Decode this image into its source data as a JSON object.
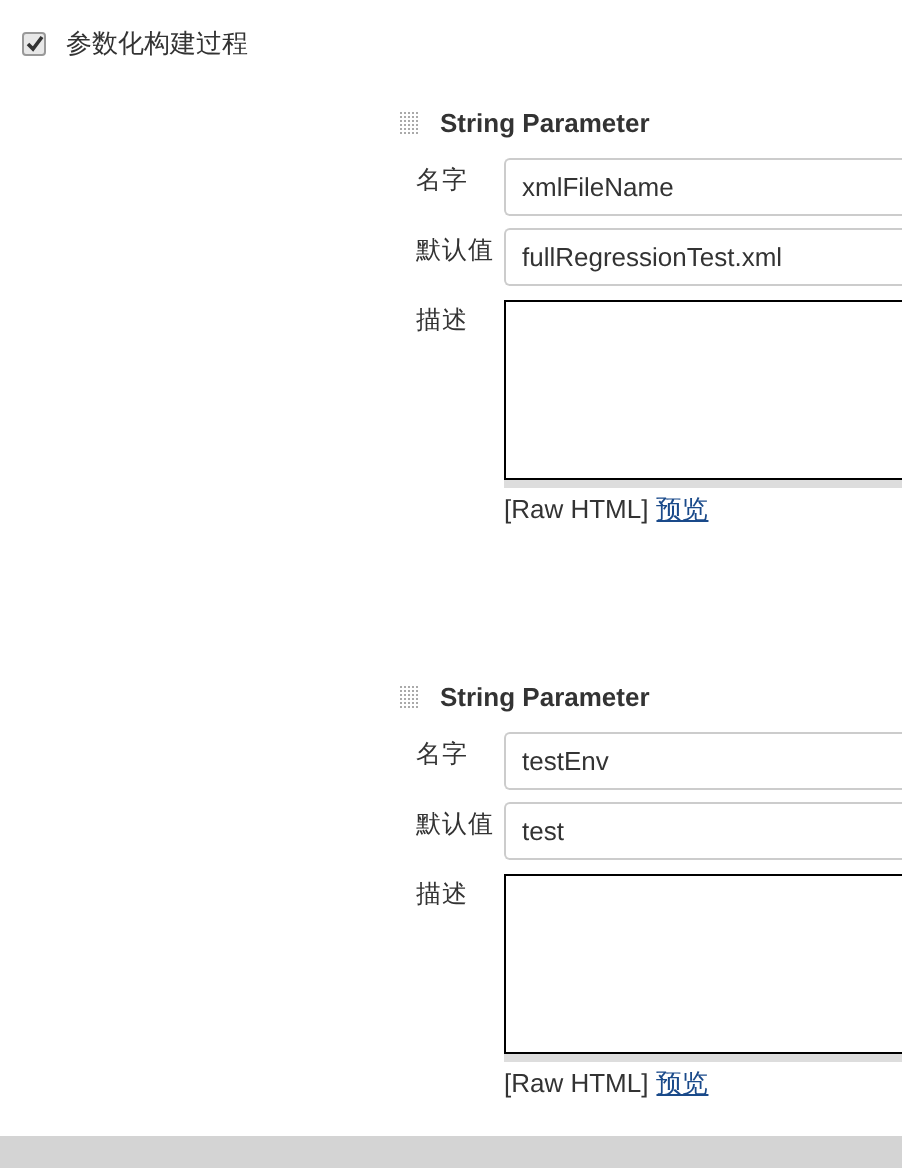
{
  "enable_checkbox": {
    "label": "参数化构建过程",
    "checked": true
  },
  "parameters": [
    {
      "title": "String Parameter",
      "fields": [
        {
          "kind": "input",
          "label": "名字",
          "value": "xmlFileName"
        },
        {
          "kind": "input",
          "label": "默认值",
          "value": "fullRegressionTest.xml"
        },
        {
          "kind": "textarea",
          "label": "描述"
        }
      ],
      "raw_html": "[Raw HTML]",
      "preview_link": "预览"
    },
    {
      "title": "String Parameter",
      "fields": [
        {
          "kind": "input",
          "label": "名字",
          "value": "testEnv"
        },
        {
          "kind": "input",
          "label": "默认值",
          "value": "test"
        },
        {
          "kind": "textarea",
          "label": "描述"
        }
      ],
      "raw_html": "[Raw HTML]",
      "preview_link": "预览"
    }
  ]
}
